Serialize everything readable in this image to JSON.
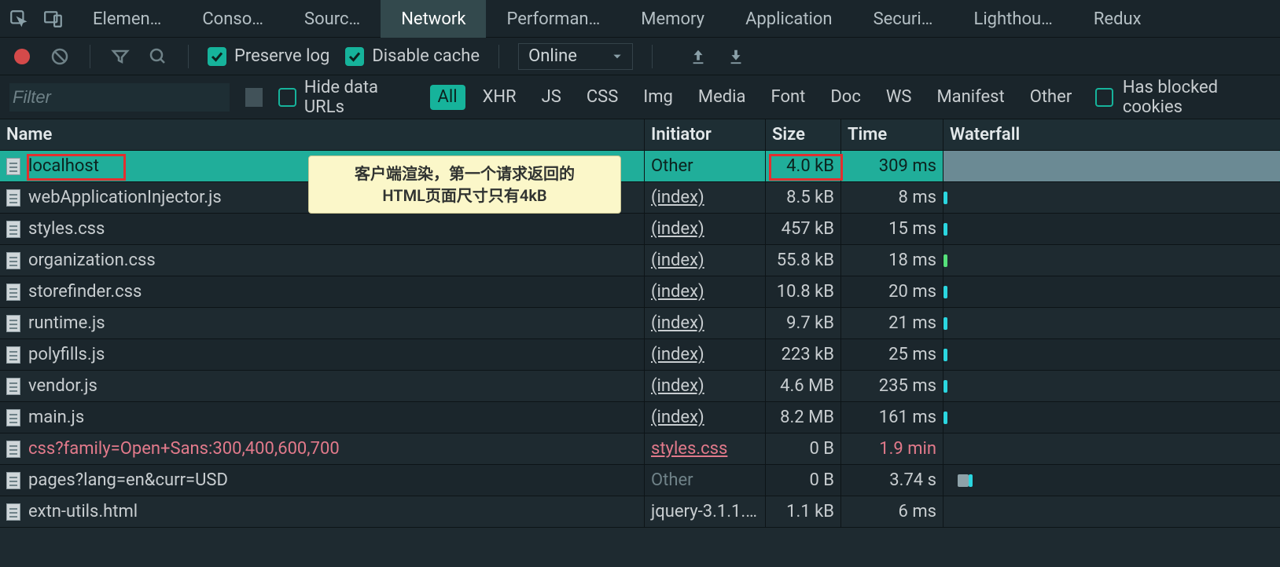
{
  "tabs": {
    "items": [
      "Elemen…",
      "Conso…",
      "Sourc…",
      "Network",
      "Performan…",
      "Memory",
      "Application",
      "Securi…",
      "Lighthou…",
      "Redux"
    ],
    "active": 3
  },
  "options": {
    "preserve_log": "Preserve log",
    "disable_cache": "Disable cache",
    "throttle": "Online"
  },
  "filters": {
    "placeholder": "Filter",
    "hide_data_urls": "Hide data URLs",
    "chips": [
      "All",
      "XHR",
      "JS",
      "CSS",
      "Img",
      "Media",
      "Font",
      "Doc",
      "WS",
      "Manifest",
      "Other"
    ],
    "chip_active": 0,
    "blocked_cookies": "Has blocked cookies"
  },
  "headers": {
    "name": "Name",
    "initiator": "Initiator",
    "size": "Size",
    "time": "Time",
    "waterfall": "Waterfall"
  },
  "callout": {
    "l1": "客户端渲染，第一个请求返回的",
    "l2": "HTML页面尺寸只有4kB"
  },
  "rows": [
    {
      "name": "localhost",
      "initiator": "Other",
      "init_type": "plain",
      "size": "4.0 kB",
      "time": "309 ms",
      "wf": "first"
    },
    {
      "name": "webApplicationInjector.js",
      "initiator": "(index)",
      "init_type": "link",
      "size": "8.5 kB",
      "time": "8 ms",
      "wf": "tick"
    },
    {
      "name": "styles.css",
      "initiator": "(index)",
      "init_type": "link",
      "size": "457 kB",
      "time": "15 ms",
      "wf": "tick"
    },
    {
      "name": "organization.css",
      "initiator": "(index)",
      "init_type": "link",
      "size": "55.8 kB",
      "time": "18 ms",
      "wf": "green"
    },
    {
      "name": "storefinder.css",
      "initiator": "(index)",
      "init_type": "link",
      "size": "10.8 kB",
      "time": "20 ms",
      "wf": "tick"
    },
    {
      "name": "runtime.js",
      "initiator": "(index)",
      "init_type": "link",
      "size": "9.7 kB",
      "time": "21 ms",
      "wf": "tick"
    },
    {
      "name": "polyfills.js",
      "initiator": "(index)",
      "init_type": "link",
      "size": "223 kB",
      "time": "25 ms",
      "wf": "tick"
    },
    {
      "name": "vendor.js",
      "initiator": "(index)",
      "init_type": "link",
      "size": "4.6 MB",
      "time": "235 ms",
      "wf": "tick"
    },
    {
      "name": "main.js",
      "initiator": "(index)",
      "init_type": "link",
      "size": "8.2 MB",
      "time": "161 ms",
      "wf": "tick"
    },
    {
      "name": "css?family=Open+Sans:300,400,600,700",
      "initiator": "styles.css",
      "init_type": "error",
      "size": "0 B",
      "time": "1.9 min",
      "time_err": true,
      "name_err": true
    },
    {
      "name": "pages?lang=en&curr=USD",
      "initiator": "Other",
      "init_type": "muted",
      "size": "0 B",
      "time": "3.74 s",
      "wf": "grey"
    },
    {
      "name": "extn-utils.html",
      "initiator": "jquery-3.1.1.…",
      "init_type": "plain",
      "size": "1.1 kB",
      "time": "6 ms"
    }
  ]
}
